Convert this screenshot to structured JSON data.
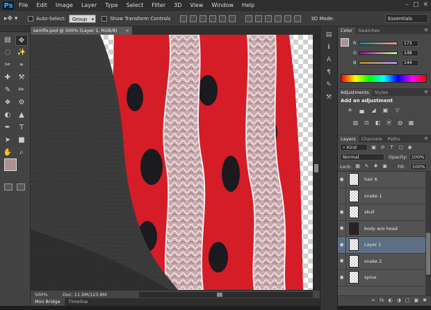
{
  "app": {
    "logo": "Ps"
  },
  "menu": [
    "File",
    "Edit",
    "Image",
    "Layer",
    "Type",
    "Select",
    "Filter",
    "3D",
    "View",
    "Window",
    "Help"
  ],
  "window_controls": [
    "–",
    "□",
    "✕"
  ],
  "options": {
    "tool_glyph": "▸✥ ▾",
    "auto_select_label": "Auto-Select:",
    "auto_select_value": "Group",
    "transform_label": "Show Transform Controls",
    "mode3d_label": "3D Mode:",
    "workspace": "Essentials"
  },
  "document": {
    "tab_title": "semfix.psd @ 500% (Layer 1, RGB/8)",
    "tab_close": "×",
    "zoom": "500%",
    "doc_info": "Doc: 11.9M/123.8M"
  },
  "bottom_tabs": [
    "Mini Bridge",
    "Timeline"
  ],
  "tools": [
    "✥",
    "▤",
    "◌",
    "✨",
    "✂",
    "⌖",
    "✚",
    "⚒",
    "✎",
    "✏",
    "❖",
    "⚙",
    "◐",
    "▲",
    "✒",
    "T",
    "➤",
    "■",
    "✋",
    "⌕"
  ],
  "colors": {
    "foreground": "#ad9090",
    "background": "#ffffff"
  },
  "color_panel": {
    "tabs": [
      "Color",
      "Swatches"
    ],
    "menu_icon": "≡",
    "sliders": [
      {
        "label": "R",
        "value": "173",
        "gradient": "linear-gradient(to right, #009090, #ff9090)"
      },
      {
        "label": "G",
        "value": "148",
        "gradient": "linear-gradient(to right, #ad0090, #adff90)"
      },
      {
        "label": "B",
        "value": "144",
        "gradient": "linear-gradient(to right, #ad9000, #ad90ff)"
      }
    ]
  },
  "adjustments": {
    "tabs": [
      "Adjustments",
      "Styles"
    ],
    "menu_icon": "≡",
    "title": "Add an adjustment",
    "row1": [
      "☀",
      "▄",
      "◢",
      "▣",
      "▽"
    ],
    "row2": [
      "▥",
      "⚖",
      "◧",
      "⦿",
      "◍",
      "▦"
    ],
    "row3": [
      "▧",
      "▨",
      "▩",
      "▤",
      "▢"
    ]
  },
  "layers": {
    "tabs": [
      "Layers",
      "Channels",
      "Paths"
    ],
    "menu_icon": "≡",
    "kind": "⌕ Kind",
    "filter_icons": [
      "▣",
      "⊘",
      "T",
      "▢",
      "◉"
    ],
    "blend_mode": "Normal",
    "opacity_label": "Opacity:",
    "opacity_value": "100%",
    "lock_label": "Lock:",
    "lock_icons": [
      "▦",
      "✎",
      "✚",
      "▣"
    ],
    "fill_label": "Fill:",
    "fill_value": "100%",
    "rows": [
      {
        "name": "hair 6",
        "visible": true,
        "thumb": "transparent"
      },
      {
        "name": "snake 1",
        "visible": false,
        "thumb": "transparent"
      },
      {
        "name": "skull",
        "visible": true,
        "thumb": "transparent"
      },
      {
        "name": "body w/o head",
        "visible": true,
        "thumb": "dark"
      },
      {
        "name": "Layer 1",
        "visible": true,
        "thumb": "transparent",
        "selected": true
      },
      {
        "name": "snake 2",
        "visible": true,
        "thumb": "transparent"
      },
      {
        "name": "spine",
        "visible": true,
        "thumb": "transparent"
      }
    ],
    "bottom_icons": [
      "∞",
      "fx",
      "◐",
      "◑",
      "□",
      "▣",
      "✖"
    ]
  }
}
